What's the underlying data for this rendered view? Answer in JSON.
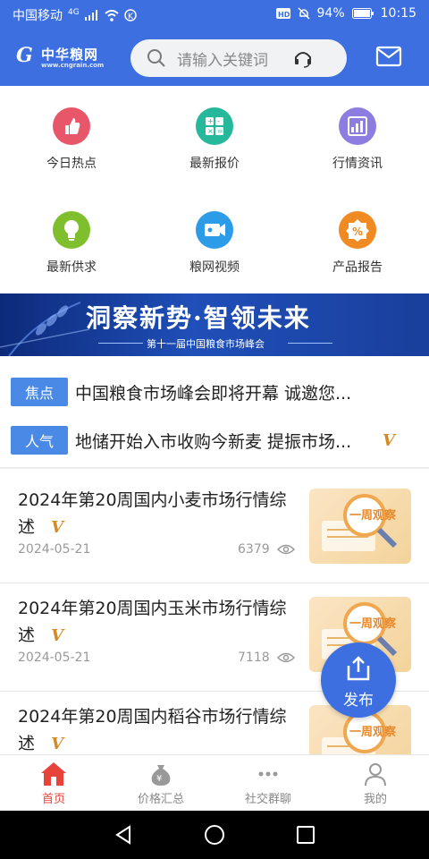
{
  "status_bar": {
    "carrier": "中国移动",
    "network": "4G",
    "battery": "94%",
    "time": "10:15"
  },
  "header": {
    "logo_cn": "中华粮网",
    "logo_en": "www.cngrain.com",
    "search_placeholder": "请输入关键词"
  },
  "quick_menu": [
    {
      "label": "今日热点",
      "icon": "thumbs-up-icon",
      "color": "#e8566a"
    },
    {
      "label": "最新报价",
      "icon": "calculator-icon",
      "color": "#26b89a"
    },
    {
      "label": "行情资讯",
      "icon": "bar-chart-icon",
      "color": "#8e7de0"
    },
    {
      "label": "最新供求",
      "icon": "lightbulb-icon",
      "color": "#7fbf2e"
    },
    {
      "label": "粮网视频",
      "icon": "video-camera-icon",
      "color": "#2c9be8"
    },
    {
      "label": "产品报告",
      "icon": "percent-badge-icon",
      "color": "#f08a22"
    }
  ],
  "banner": {
    "headline": "洞察新势·智领未来",
    "subline": "第十一届中国粮食市场峰会"
  },
  "news_ticker": [
    {
      "tag": "焦点",
      "text": "中国粮食市场峰会即将开幕 诚邀您...",
      "vip": ""
    },
    {
      "tag": "人气",
      "text": "地储开始入市收购今新麦 提振市场...",
      "vip": "V"
    }
  ],
  "articles": [
    {
      "title": "2024年第20周国内小麦市场行情综述",
      "vip": "V",
      "date": "2024-05-21",
      "views": "6379",
      "thumb_text": "一周观察"
    },
    {
      "title": "2024年第20周国内玉米市场行情综述",
      "vip": "V",
      "date": "2024-05-21",
      "views": "7118",
      "thumb_text": "一周观察"
    },
    {
      "title": "2024年第20周国内稻谷市场行情综述",
      "vip": "V",
      "date": "",
      "views": "",
      "thumb_text": "一周观察"
    }
  ],
  "fab": {
    "label": "发布"
  },
  "tabs": [
    {
      "label": "首页",
      "active": true
    },
    {
      "label": "价格汇总",
      "active": false
    },
    {
      "label": "社交群聊",
      "active": false
    },
    {
      "label": "我的",
      "active": false
    }
  ],
  "colors": {
    "primary": "#3d6fe0",
    "tag_blue": "#4a8ae6",
    "vip_orange": "#d68a24",
    "active_tab": "#e8433a"
  }
}
